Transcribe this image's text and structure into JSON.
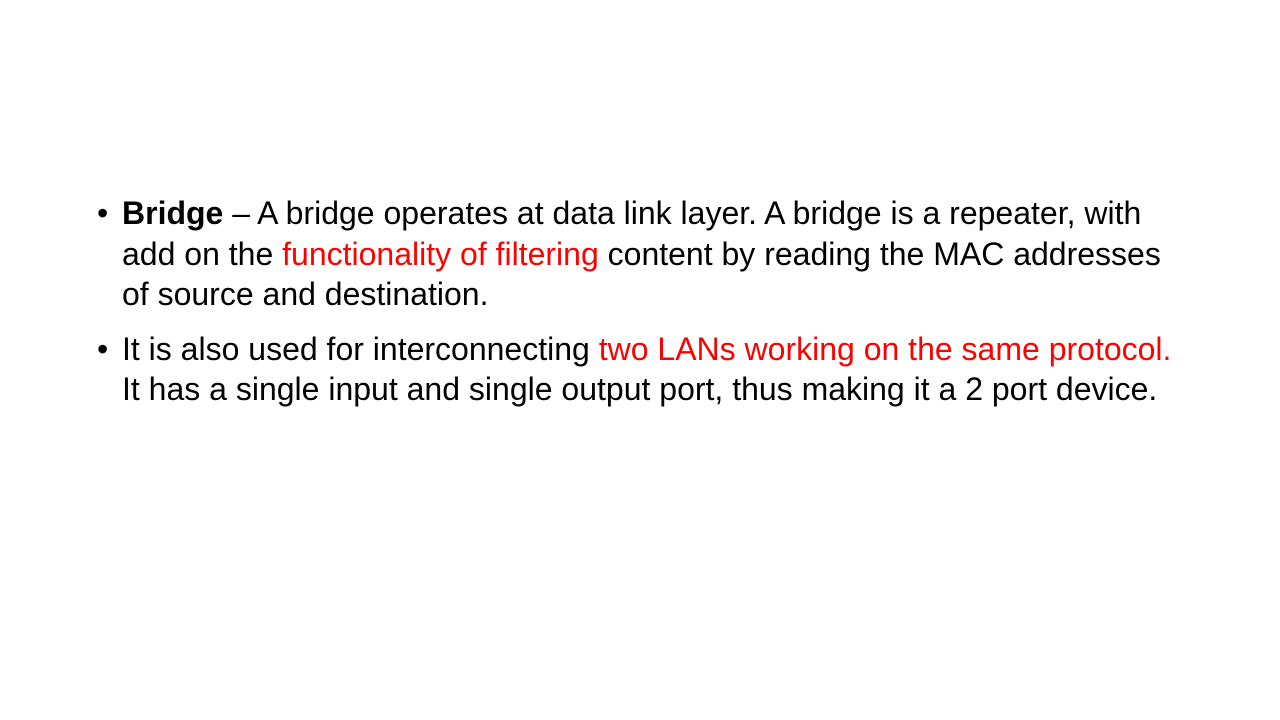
{
  "slide": {
    "bullet_glyph": "•",
    "highlight_color": "#ff0000",
    "bullets": [
      {
        "term": "Bridge",
        "text_1": " – A bridge operates at data link layer. A bridge is a repeater,  with add on the ",
        "highlight": "functionality of filtering",
        "text_2": " content by reading the MAC  addresses of source and destination."
      },
      {
        "text_1": "It is also used for interconnecting ",
        "highlight": "two LANs working on the same  protocol.",
        "text_2": " It has a single input and single output port, thus making it a  2 port device."
      }
    ]
  }
}
